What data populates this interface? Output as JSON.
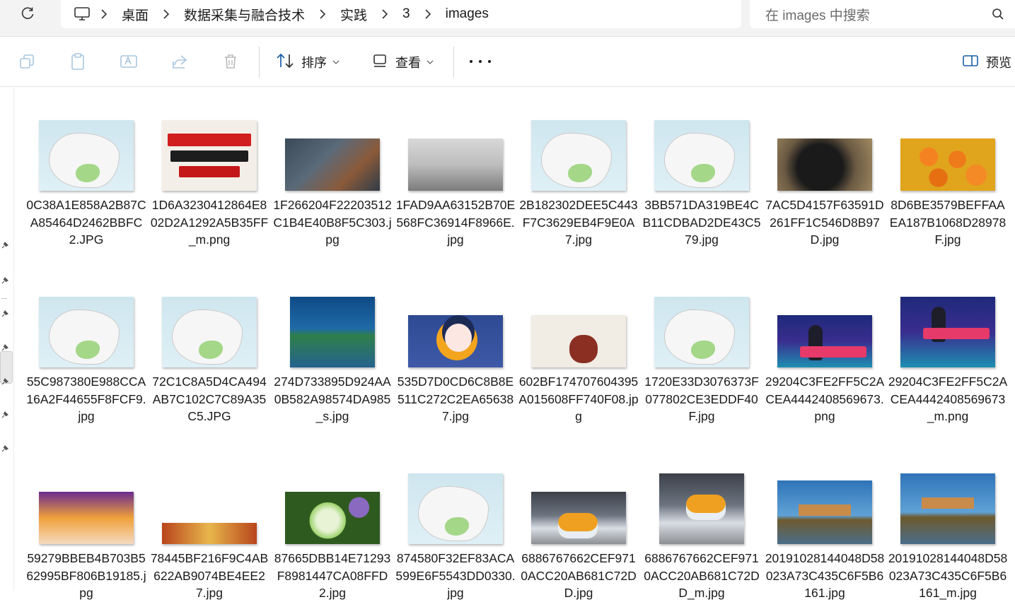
{
  "address_bar": {
    "breadcrumbs": [
      "桌面",
      "数据采集与融合技术",
      "实践",
      "3",
      "images"
    ],
    "search_placeholder": "在 images 中搜索"
  },
  "command_bar": {
    "sort_label": "排序",
    "view_label": "查看",
    "preview_label": "预览"
  },
  "files": [
    {
      "name": "0C38A1E858A2B87CA85464D2462BBFC2.JPG",
      "thumb": "weather-map"
    },
    {
      "name": "1D6A3230412864E802D2A1292A5B35FF_m.png",
      "thumb": "cold-wave-text-graphic"
    },
    {
      "name": "1F266204F22203512C1B4E40B8F5C303.jpg",
      "thumb": "frozen-ice-photo"
    },
    {
      "name": "1FAD9AA63152B70E568FC36914F8966E.jpg",
      "thumb": "foggy-worker-photo"
    },
    {
      "name": "2B182302DEE5C443F7C3629EB4F9E0A7.jpg",
      "thumb": "weather-map"
    },
    {
      "name": "3BB571DA319BE4CB11CDBAD2DE43C579.jpg",
      "thumb": "weather-map"
    },
    {
      "name": "7AC5D4157F63591D261FF1C546D8B97D.jpg",
      "thumb": "windblown-hair-photo"
    },
    {
      "name": "8D6BE3579BEFFAAEA187B1068D28978F.jpg",
      "thumb": "persimmons-crate-photo"
    },
    {
      "name": "55C987380E988CCA16A2F44655F8FCF9.jpg",
      "thumb": "weather-map"
    },
    {
      "name": "72C1C8A5D4CA494AB7C102C7C89A35C5.JPG",
      "thumb": "weather-map"
    },
    {
      "name": "274D733895D924AA0B582A98574DA985_s.jpg",
      "thumb": "forecast-table"
    },
    {
      "name": "535D7D0CD6C8B8E511C272C2EA656387.jpg",
      "thumb": "sleeping-cartoon"
    },
    {
      "name": "602BF174707604395A015608FF740F08.jpg",
      "thumb": "pickle-jar-illustration"
    },
    {
      "name": "1720E33D3076373F077802CE3EDDF40F.jpg",
      "thumb": "weather-map"
    },
    {
      "name": "29204C3FE2FF5C2ACEA4442408569673.png",
      "thumb": "weather-news-anchor"
    },
    {
      "name": "29204C3FE2FF5C2ACEA4442408569673_m.png",
      "thumb": "weather-news-anchor"
    },
    {
      "name": "59279BBEB4B703B562995BF806B19185.jpg",
      "thumb": "snowy-houses-photo"
    },
    {
      "name": "78445BF216F9C4AB622AB9074BE4EE27.jpg",
      "thumb": "banner-strip"
    },
    {
      "name": "87665DBB14E71293F8981447CA08FFD2.jpg",
      "thumb": "green-flower-photo"
    },
    {
      "name": "874580F32EF83ACA599E6F5543DD0330.jpg",
      "thumb": "weather-map"
    },
    {
      "name": "6886767662CEF9710ACC20AB681C72DD.jpg",
      "thumb": "snowy-motorbike-photo"
    },
    {
      "name": "6886767662CEF9710ACC20AB681C72DD_m.jpg",
      "thumb": "snowy-motorbike-photo"
    },
    {
      "name": "20191028144048D58023A73C435C6F5B6161.jpg",
      "thumb": "castle-lake-photo"
    },
    {
      "name": "20191028144048D58023A73C435C6F5B6161_m.jpg",
      "thumb": "castle-lake-photo"
    }
  ],
  "icons": {
    "refresh": "refresh-icon",
    "this_pc": "monitor-icon",
    "search": "search-icon",
    "copy": "copy-icon",
    "paste": "paste-icon",
    "rename": "rename-icon",
    "share": "share-icon",
    "delete": "trash-icon",
    "sort": "sort-arrows-icon",
    "view": "view-icon",
    "more": "more-dots-icon",
    "preview": "preview-pane-icon",
    "pin": "pin-icon"
  }
}
